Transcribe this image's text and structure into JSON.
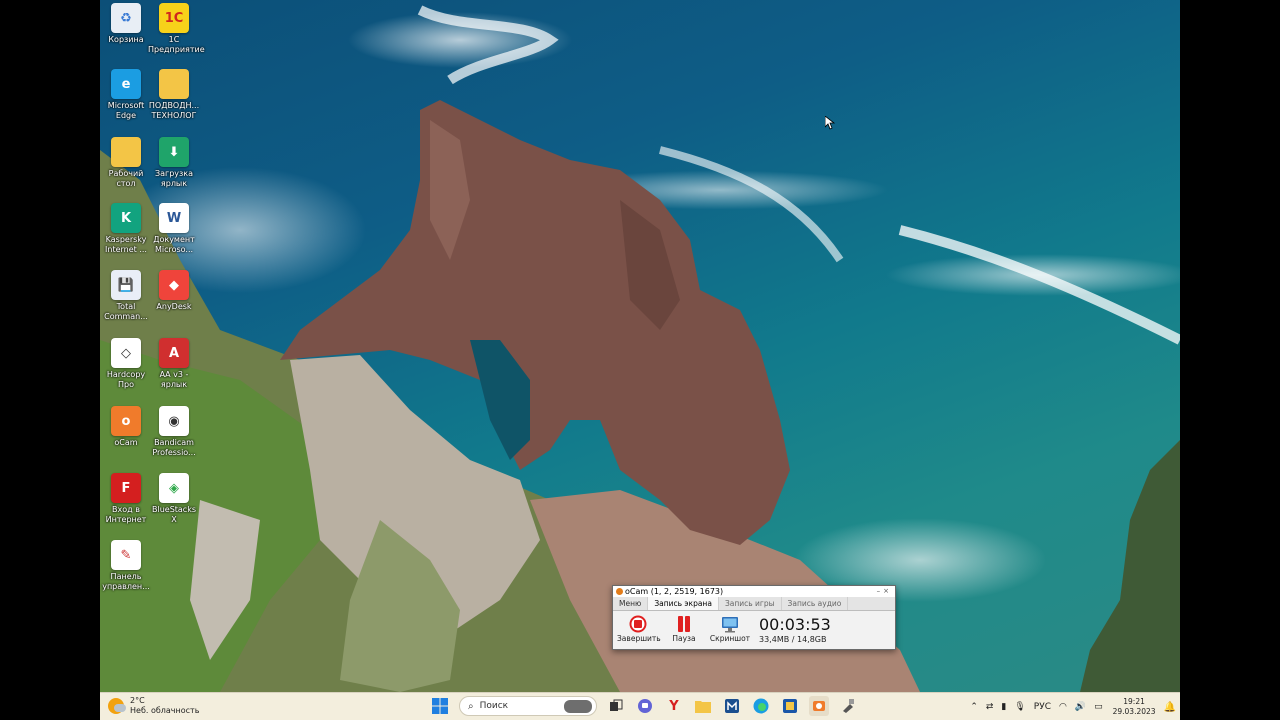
{
  "desktop_icons": [
    {
      "name": "recycle-bin-icon",
      "label": "Корзина",
      "color": "#e8eef5",
      "glyph": "♻",
      "glyph_color": "#3a7bd5"
    },
    {
      "name": "1c-enterprise-icon",
      "label": "1С\nПредприятие",
      "color": "#f7d21a",
      "glyph": "1С",
      "glyph_color": "#d0261d"
    },
    {
      "name": "microsoft-edge-icon",
      "label": "Microsoft\nEdge",
      "color": "#1b9de2",
      "glyph": "e",
      "glyph_color": "#ffffff"
    },
    {
      "name": "folder-podvodn-icon",
      "label": "ПОДВОДН...\nТЕХНОЛОГ",
      "color": "#f3c546",
      "glyph": "",
      "glyph_color": "#ffffff"
    },
    {
      "name": "folder-desktop-icon",
      "label": "Рабочий\nстол",
      "color": "#f3c546",
      "glyph": "",
      "glyph_color": "#ffffff"
    },
    {
      "name": "download-shortcut-icon",
      "label": "Загрузка\nярлык",
      "color": "#1fa46a",
      "glyph": "⬇",
      "glyph_color": "#ffffff"
    },
    {
      "name": "kaspersky-icon",
      "label": "Kaspersky\nInternet ...",
      "color": "#12a37f",
      "glyph": "K",
      "glyph_color": "#ffffff"
    },
    {
      "name": "word-document-icon",
      "label": "Документ\nMicroso...",
      "color": "#ffffff",
      "glyph": "W",
      "glyph_color": "#2b5797"
    },
    {
      "name": "total-commander-icon",
      "label": "Total\nComman...",
      "color": "#e9eef7",
      "glyph": "💾",
      "glyph_color": "#1b3f8a"
    },
    {
      "name": "anydesk-icon",
      "label": "AnyDesk",
      "color": "#ef443b",
      "glyph": "◆",
      "glyph_color": "#ffffff"
    },
    {
      "name": "hardcopy-icon",
      "label": "Hardcopy\nПро",
      "color": "#ffffff",
      "glyph": "◇",
      "glyph_color": "#333333"
    },
    {
      "name": "aa-shortcut-icon",
      "label": "АА v3 -\nярлык",
      "color": "#d02f2f",
      "glyph": "A",
      "glyph_color": "#ffffff"
    },
    {
      "name": "ocam-icon",
      "label": "oCam",
      "color": "#f07b2b",
      "glyph": "o",
      "glyph_color": "#ffffff"
    },
    {
      "name": "bandicam-icon",
      "label": "Bandicam\nProfessio...",
      "color": "#ffffff",
      "glyph": "◉",
      "glyph_color": "#333333"
    },
    {
      "name": "internet-login-icon",
      "label": "Вход в\nИнтернет",
      "color": "#d41f1f",
      "glyph": "F",
      "glyph_color": "#ffffff"
    },
    {
      "name": "bluestacks-icon",
      "label": "BlueStacks X",
      "color": "#ffffff",
      "glyph": "◈",
      "glyph_color": "#2ea84a"
    },
    {
      "name": "control-panel-icon",
      "label": "Панель\nуправлен...",
      "color": "#ffffff",
      "glyph": "✎",
      "glyph_color": "#cc3333"
    }
  ],
  "ocam": {
    "title": "oCam (1, 2, 2519, 1673)",
    "tabs": [
      {
        "label": "Меню",
        "active": false
      },
      {
        "label": "Запись экрана",
        "active": true
      },
      {
        "label": "Запись игры",
        "active": false
      },
      {
        "label": "Запись аудио",
        "active": false
      }
    ],
    "buttons": {
      "stop": "Завершить",
      "pause": "Пауза",
      "screenshot": "Скриншот"
    },
    "timer": "00:03:53",
    "size_info": "33,4MB / 14,8GB",
    "stop_color": "#e02020",
    "pause_color": "#e02020"
  },
  "taskbar": {
    "weather_temp": "2°C",
    "weather_desc": "Неб. облачность",
    "search_placeholder": "Поиск",
    "language": "РУС",
    "time": "19:21",
    "date": "29.03.2023"
  }
}
